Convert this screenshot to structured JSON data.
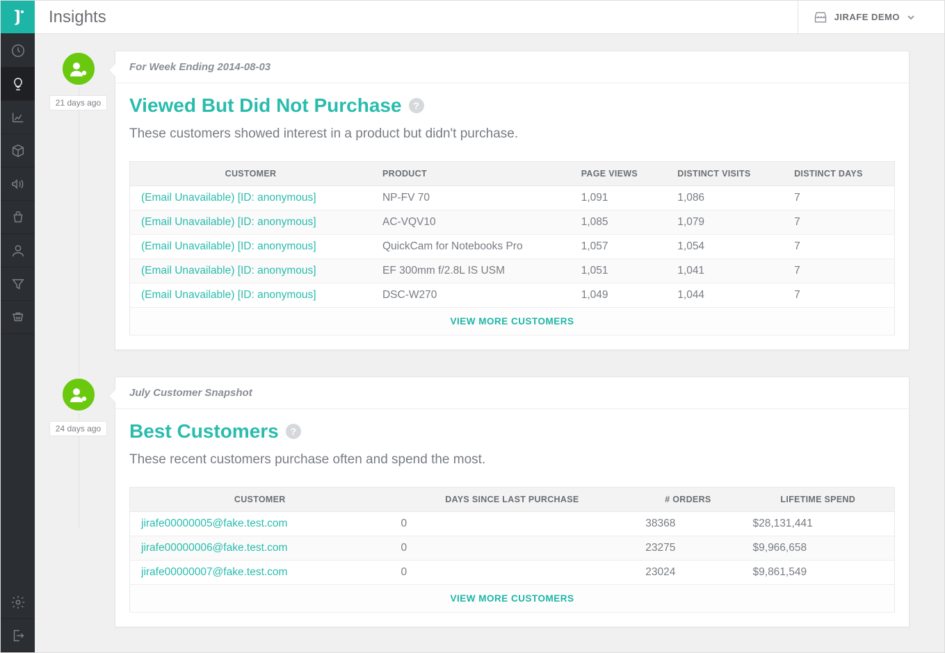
{
  "header": {
    "title": "Insights",
    "account_label": "JIRAFE DEMO"
  },
  "insights": [
    {
      "time_ago": "21 days ago",
      "meta": "For Week Ending 2014-08-03",
      "title": "Viewed But Did Not Purchase",
      "subtitle": "These customers showed interest in a product but didn't purchase.",
      "columns": [
        "CUSTOMER",
        "PRODUCT",
        "PAGE VIEWS",
        "DISTINCT VISITS",
        "DISTINCT DAYS"
      ],
      "rows": [
        {
          "customer": "(Email Unavailable) [ID: anonymous]",
          "product": "NP-FV 70",
          "page_views": "1,091",
          "visits": "1,086",
          "days": "7"
        },
        {
          "customer": "(Email Unavailable) [ID: anonymous]",
          "product": "AC-VQV10",
          "page_views": "1,085",
          "visits": "1,079",
          "days": "7"
        },
        {
          "customer": "(Email Unavailable) [ID: anonymous]",
          "product": "QuickCam for Notebooks Pro",
          "page_views": "1,057",
          "visits": "1,054",
          "days": "7"
        },
        {
          "customer": "(Email Unavailable) [ID: anonymous]",
          "product": "EF 300mm f/2.8L IS USM",
          "page_views": "1,051",
          "visits": "1,041",
          "days": "7"
        },
        {
          "customer": "(Email Unavailable) [ID: anonymous]",
          "product": "DSC-W270",
          "page_views": "1,049",
          "visits": "1,044",
          "days": "7"
        }
      ],
      "view_more": "VIEW MORE CUSTOMERS"
    },
    {
      "time_ago": "24 days ago",
      "meta": "July Customer Snapshot",
      "title": "Best Customers",
      "subtitle": "These recent customers purchase often and spend the most.",
      "columns": [
        "CUSTOMER",
        "DAYS SINCE LAST PURCHASE",
        "# ORDERS",
        "LIFETIME SPEND"
      ],
      "rows": [
        {
          "customer": "jirafe00000005@fake.test.com",
          "days_since": "0",
          "orders": "38368",
          "spend": "$28,131,441"
        },
        {
          "customer": "jirafe00000006@fake.test.com",
          "days_since": "0",
          "orders": "23275",
          "spend": "$9,966,658"
        },
        {
          "customer": "jirafe00000007@fake.test.com",
          "days_since": "0",
          "orders": "23024",
          "spend": "$9,861,549"
        }
      ],
      "view_more": "VIEW MORE CUSTOMERS"
    }
  ]
}
